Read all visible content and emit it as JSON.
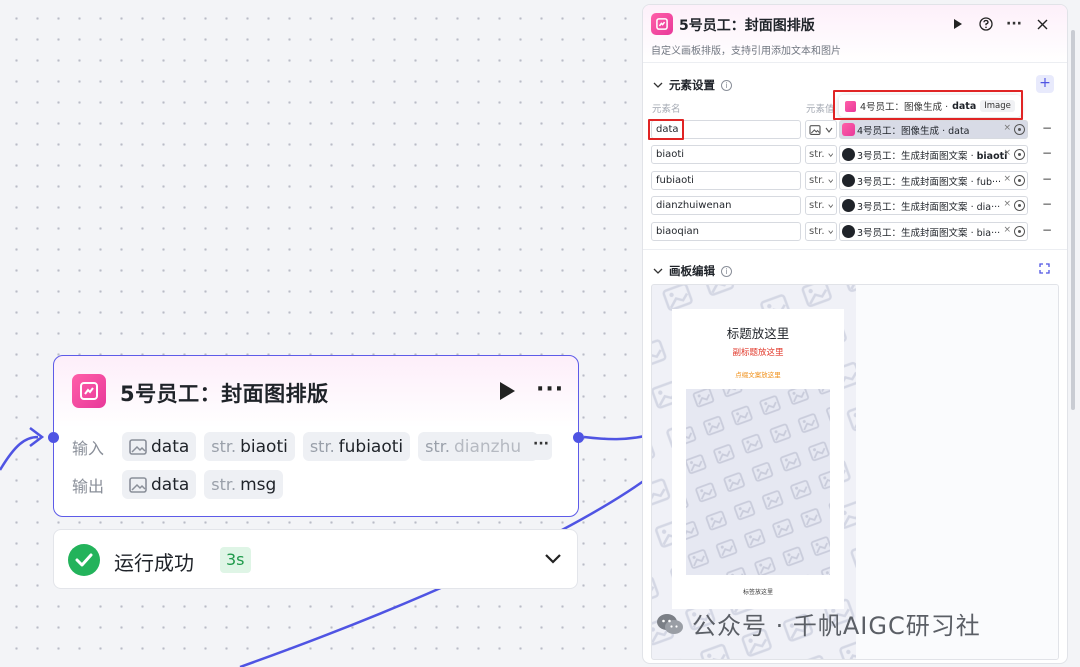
{
  "node": {
    "title": "5号员工：封面图排版",
    "input_label": "输入",
    "output_label": "输出",
    "inputs": [
      {
        "type": "",
        "name": "data"
      },
      {
        "type": "str.",
        "name": "biaoti"
      },
      {
        "type": "str.",
        "name": "fubiaoti"
      },
      {
        "type": "str.",
        "name": "dianzhu"
      }
    ],
    "outputs": [
      {
        "type": "",
        "name": "data"
      },
      {
        "type": "str.",
        "name": "msg"
      }
    ],
    "more_label": "···",
    "status": "运行成功",
    "duration": "3s",
    "icons": {
      "run": "play-icon",
      "more": "more-icon",
      "status": "check-circle-icon",
      "expand": "chevron-down-icon"
    },
    "colors": {
      "accent": "#4f54e3",
      "brand": "#e8399a",
      "success": "#23b35b"
    }
  },
  "panel": {
    "title": "5号员工：封面图排版",
    "subtitle": "自定义画板排版，支持引用添加文本和图片",
    "element_section": "元素设置",
    "col_name": "元素名",
    "col_value": "元素值",
    "tooltip": {
      "prefix": "4号员工：图像生成 · ",
      "strong": "data",
      "tag": "Image"
    },
    "elements": [
      {
        "name": "data",
        "type": "",
        "source": "4号员工：图像生成 · ",
        "field": "data"
      },
      {
        "name": "biaoti",
        "type": "str.",
        "source": "3号员工：生成封面图文案 · ",
        "field": "biaoti"
      },
      {
        "name": "fubiaoti",
        "type": "str.",
        "source": "3号员工：生成封面图文案 · ",
        "field": "fub···"
      },
      {
        "name": "dianzhuiwenan",
        "type": "str.",
        "source": "3号员工：生成封面图文案 · ",
        "field": "dia···"
      },
      {
        "name": "biaoqian",
        "type": "str.",
        "source": "3号员工：生成封面图文案 · ",
        "field": "bia···"
      }
    ],
    "canvas_section": "画板编辑",
    "artboard": {
      "title": "标题放这里",
      "subtitle": "副标题放这里",
      "text": "点缀文案放这里",
      "tag": "标签放这里"
    }
  },
  "watermark": "公众号 · 千帆AIGC研习社"
}
